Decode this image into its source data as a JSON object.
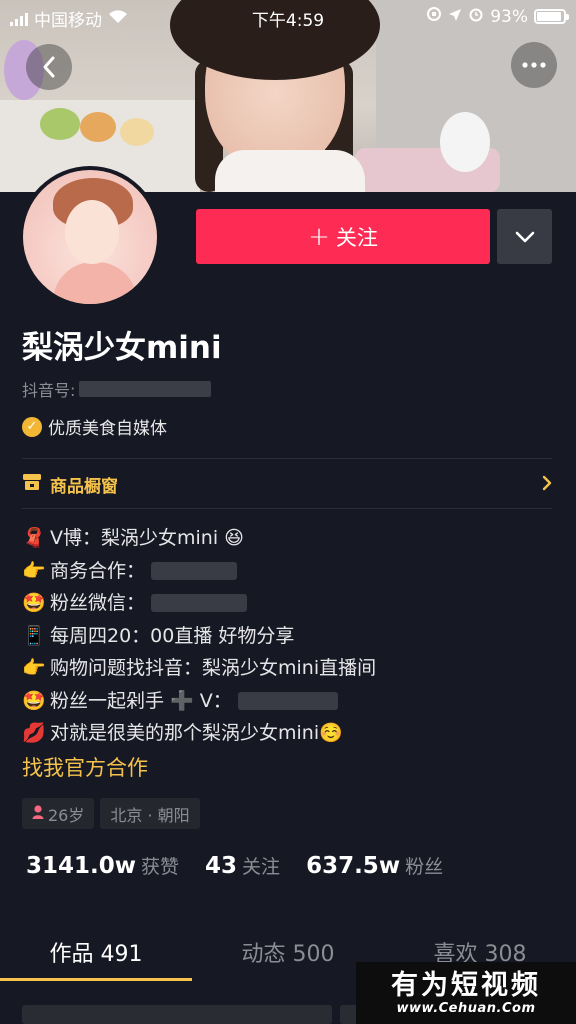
{
  "status_bar": {
    "carrier": "中国移动",
    "time": "下午4:59",
    "battery": "93%",
    "battery_level": 0.93
  },
  "profile": {
    "follow_label": "关注",
    "nickname": "梨涡少女mini",
    "douyin_id_label": "抖音号:",
    "verification": "优质美食自媒体",
    "shop_window": "商品橱窗",
    "bio_lines": [
      {
        "emoji": "🧣",
        "text": "V博：梨涡少女mini 😆"
      },
      {
        "emoji": "👉",
        "text": "商务合作："
      },
      {
        "emoji": "🤩",
        "text": "粉丝微信："
      },
      {
        "emoji": "📱",
        "text": "每周四20：00直播 好物分享"
      },
      {
        "emoji": "👉",
        "text": "购物问题找抖音：梨涡少女mini直播间"
      },
      {
        "emoji": "🤩",
        "text": "粉丝一起剁手 ➕ V："
      },
      {
        "emoji": "💋",
        "text": "对就是很美的那个梨涡少女mini☺️"
      }
    ],
    "official_coop": "找我官方合作",
    "tags": {
      "age": "26岁",
      "location": "北京 · 朝阳"
    },
    "stats": {
      "likes_num": "3141.0w",
      "likes_label": "获赞",
      "following_num": "43",
      "following_label": "关注",
      "fans_num": "637.5w",
      "fans_label": "粉丝"
    },
    "tabs": [
      "作品 491",
      "动态 500",
      "喜欢 308"
    ]
  },
  "watermark": {
    "cn": "有为短视频",
    "en": "www.Cehuan.Com"
  },
  "colors": {
    "accent": "#fe2c55",
    "gold": "#f5c24c",
    "background": "#161823"
  }
}
